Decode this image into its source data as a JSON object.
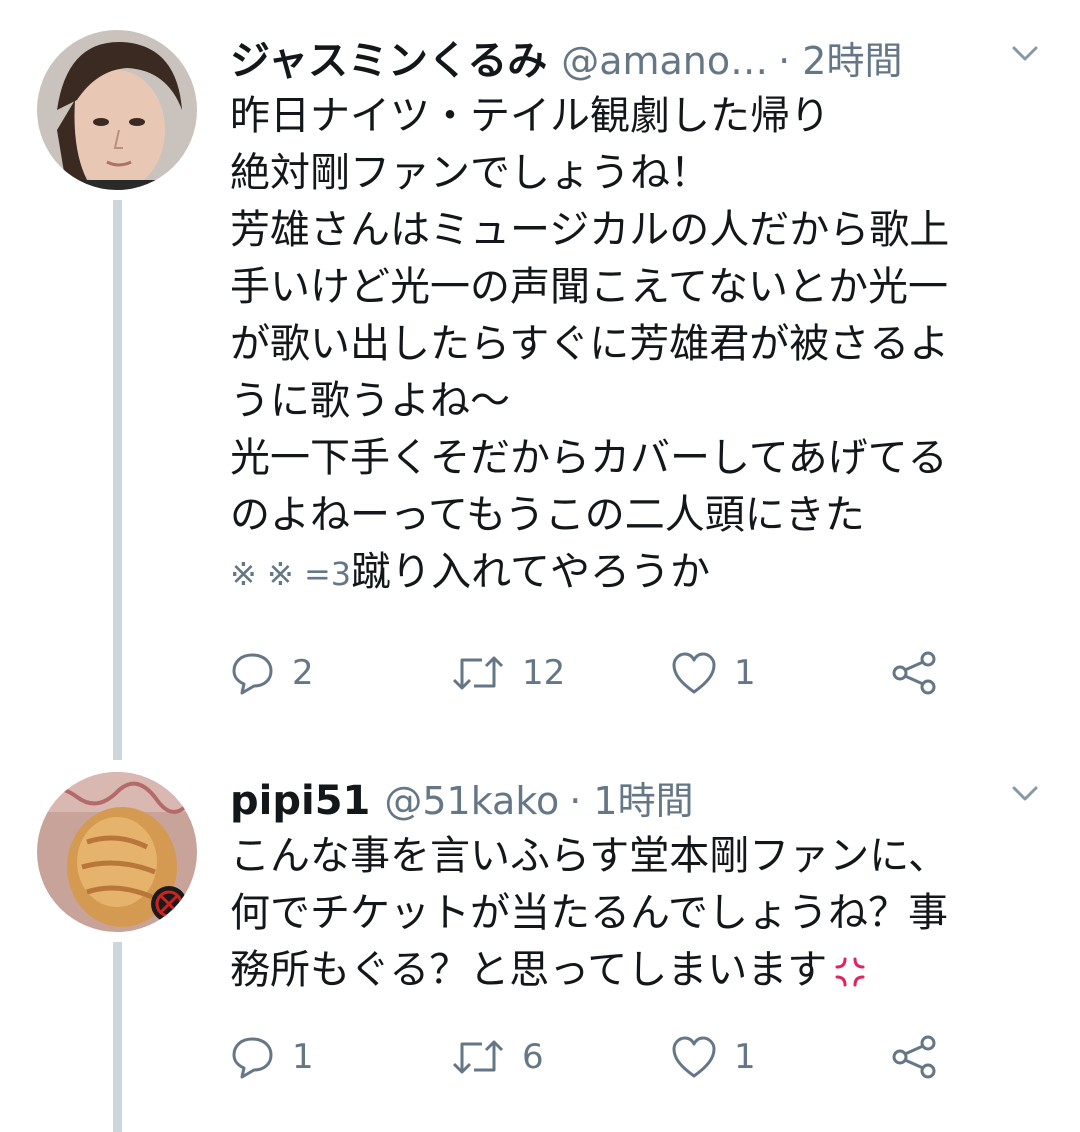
{
  "tweets": [
    {
      "avatar_icon": "user-avatar-portrait",
      "display_name": "ジャスミンくるみ",
      "handle": "@amano…",
      "time": "· 2時間",
      "lines": [
        "昨日ナイツ・テイル観劇した帰り",
        "絶対剛ファンでしょうね！",
        "芳雄さんはミュージカルの人だから歌上",
        "手いけど光一の声聞こえてないとか光一",
        "が歌い出したらすぐに芳雄君が被さるよ",
        "うに歌うよね〜",
        "光一下手くそだからカバーしてあげてる",
        "のよねーってもうこの二人頭にきた"
      ],
      "last_line_marks": "※ ※ =3",
      "last_line_text": "蹴り入れてやろうか",
      "reply_count": "2",
      "retweet_count": "12",
      "like_count": "1"
    },
    {
      "avatar_icon": "cat-avatar",
      "display_name": "pipi51",
      "handle": "@51kako",
      "time": "· 1時間",
      "lines": [
        "こんな事を言いふらす堂本剛ファンに、",
        "何でチケットが当たるんでしょうね？事"
      ],
      "last_line_text": "務所もぐる？と思ってしまいます",
      "last_line_emoji": "anger-icon",
      "reply_count": "1",
      "retweet_count": "6",
      "like_count": "1"
    }
  ],
  "colors": {
    "text": "#14171a",
    "secondary": "#657786",
    "thread_line": "#ccd6dd",
    "anger": "#e0245e"
  }
}
